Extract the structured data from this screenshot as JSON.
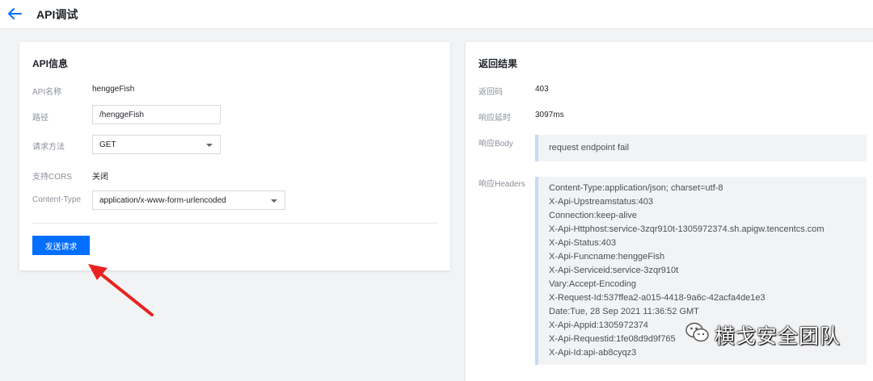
{
  "header": {
    "title": "API调试"
  },
  "api_info": {
    "title": "API信息",
    "name_label": "API名称",
    "name_value": "henggeFish",
    "path_label": "路径",
    "path_value": "/henggeFish",
    "method_label": "请求方法",
    "method_value": "GET",
    "cors_label": "支持CORS",
    "cors_value": "关闭",
    "content_type_label": "Content-Type",
    "content_type_value": "application/x-www-form-urlencoded",
    "send_label": "发送请求"
  },
  "result": {
    "title": "返回结果",
    "code_label": "返回码",
    "code_value": "403",
    "latency_label": "响应延时",
    "latency_value": "3097ms",
    "body_label": "响应Body",
    "body_value": "request endpoint fail",
    "headers_label": "响应Headers",
    "headers": [
      "Content-Type:application/json; charset=utf-8",
      "X-Api-Upstreamstatus:403",
      "Connection:keep-alive",
      "X-Api-Httphost:service-3zqr910t-1305972374.sh.apigw.tencentcs.com",
      "X-Api-Status:403",
      "X-Api-Funcname:henggeFish",
      "X-Api-Serviceid:service-3zqr910t",
      "Vary:Accept-Encoding",
      "X-Request-Id:537ffea2-a015-4418-9a6c-42acfa4de1e3",
      "Date:Tue, 28 Sep 2021 11:36:52 GMT",
      "X-Api-Appid:1305972374",
      "X-Api-Requestid:1fe08d9d9f765",
      "X-Api-Id:api-ab8cyqz3"
    ]
  },
  "watermark": {
    "text": "横戈安全团队"
  },
  "colors": {
    "primary": "#006eff",
    "arrow": "#e8231f",
    "accent_bar": "#c5daf7"
  }
}
